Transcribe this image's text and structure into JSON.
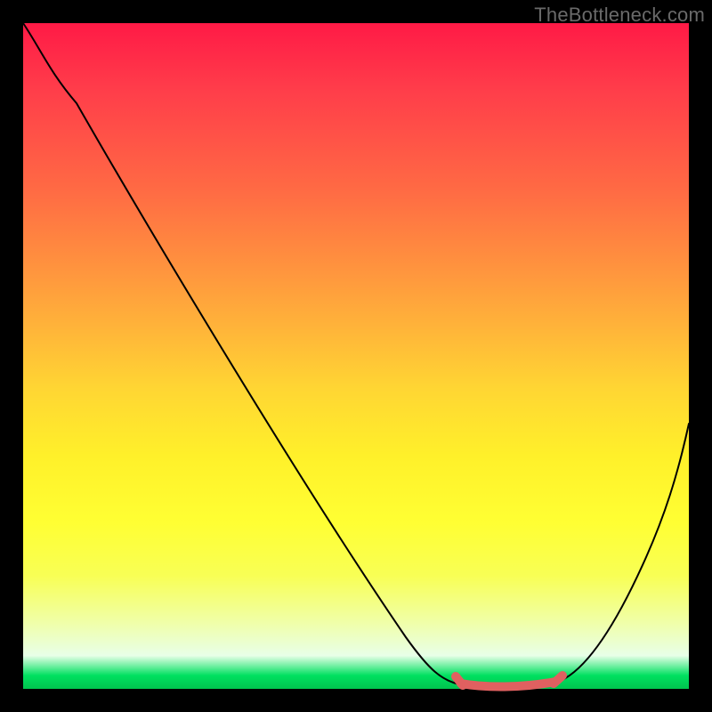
{
  "watermark": "TheBottleneck.com",
  "colors": {
    "gradient_top": "#ff1a46",
    "gradient_mid": "#fff02a",
    "gradient_bottom": "#00c44e",
    "curve": "#000000",
    "highlight": "#e06060",
    "frame": "#000000"
  },
  "chart_data": {
    "type": "line",
    "title": "",
    "xlabel": "",
    "ylabel": "",
    "xlim": [
      0,
      100
    ],
    "ylim": [
      0,
      100
    ],
    "grid": false,
    "legend": false,
    "note": "No axis ticks or labels are rendered; values are estimated from pixel positions.",
    "series": [
      {
        "name": "curve",
        "x": [
          0,
          4,
          10,
          20,
          30,
          40,
          50,
          58,
          62,
          66,
          70,
          74,
          78,
          82,
          88,
          94,
          100
        ],
        "y": [
          100,
          95,
          88,
          73,
          58,
          42,
          27,
          14,
          6,
          2,
          0,
          0,
          0,
          2,
          9,
          22,
          40
        ]
      }
    ],
    "highlight_range": {
      "x_start": 66,
      "x_end": 80,
      "y": 0
    }
  }
}
